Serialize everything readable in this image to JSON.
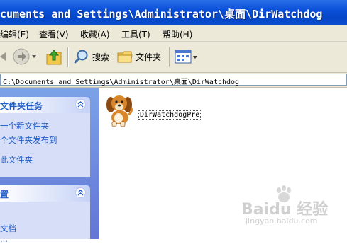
{
  "window": {
    "title": "cuments and Settings\\Administrator\\桌面\\DirWatchdog"
  },
  "menu": {
    "items": [
      {
        "label": "编辑(E)"
      },
      {
        "label": "查看(V)"
      },
      {
        "label": "收藏(A)"
      },
      {
        "label": "工具(T)"
      },
      {
        "label": "帮助(H)"
      }
    ]
  },
  "toolbar": {
    "search_label": "搜索",
    "folders_label": "文件夹"
  },
  "address": {
    "path": "C:\\Documents and Settings\\Administrator\\桌面\\DirWatchdog"
  },
  "left_pane": {
    "file_tasks": {
      "title": "文件夹任务",
      "links": [
        "一个新文件夹",
        "个文件夹发布到",
        "此文件夹"
      ]
    },
    "other_places": {
      "title": "置",
      "links": [
        "",
        "文档",
        "..."
      ]
    }
  },
  "content": {
    "files": [
      {
        "name": "DirWatchdogPre",
        "icon": "dog-icon"
      }
    ]
  },
  "watermark": {
    "brand": "Baidu 经验",
    "url": "jingyan.baidu.com"
  },
  "colors": {
    "titlebar": "#0a4fd8",
    "pane": "#6f8fe0",
    "link": "#215dc6"
  }
}
